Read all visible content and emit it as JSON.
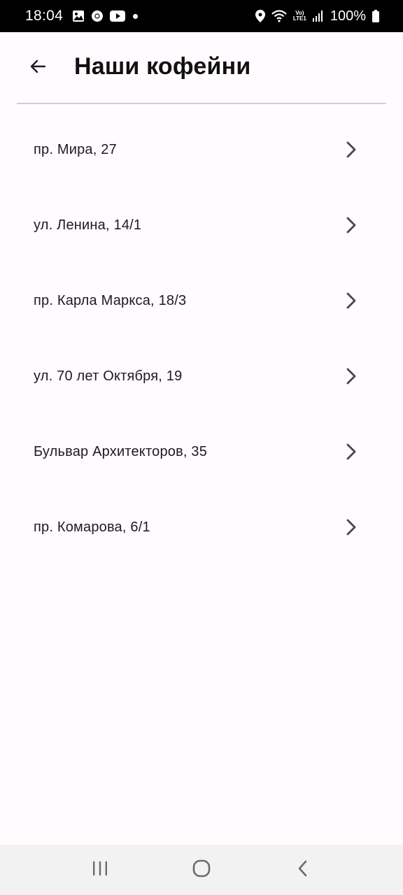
{
  "status_bar": {
    "time": "18:04",
    "lte_top": "Vo)",
    "lte_bottom": "LTE1",
    "battery": "100%"
  },
  "app_bar": {
    "title": "Наши кофейни"
  },
  "coffee_shops": [
    {
      "address": "пр. Мира, 27"
    },
    {
      "address": "ул. Ленина, 14/1"
    },
    {
      "address": "пр. Карла Маркса, 18/3"
    },
    {
      "address": "ул. 70 лет Октября, 19"
    },
    {
      "address": "Бульвар Архитекторов, 35"
    },
    {
      "address": "пр. Комарова, 6/1"
    }
  ],
  "icons": {
    "back": "arrow-left-icon",
    "chevron": "chevron-right-icon",
    "nav_recents": "recents-icon",
    "nav_home": "home-icon",
    "nav_back": "back-icon"
  },
  "colors": {
    "background": "#fffbfe",
    "status_bar": "#000000",
    "nav_bar": "#f2f2f2",
    "divider": "#cfcfcf",
    "chevron": "#49454f"
  }
}
